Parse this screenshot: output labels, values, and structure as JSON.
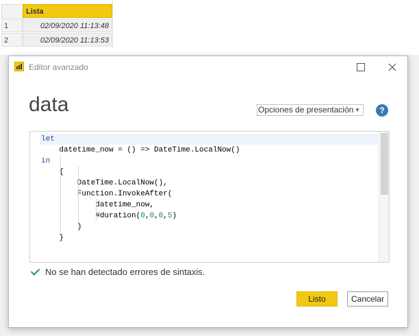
{
  "grid": {
    "column_header": "Lista",
    "rows": [
      {
        "num": "1",
        "value": "02/09/2020 11:13:48"
      },
      {
        "num": "2",
        "value": "02/09/2020 11:13:53"
      }
    ]
  },
  "dialog": {
    "title": "Editor avanzado",
    "query_name": "data",
    "options_label": "Opciones de presentación",
    "help_glyph": "?",
    "status_text": "No se han detectado errores de sintaxis.",
    "ok_label": "Listo",
    "cancel_label": "Cancelar"
  },
  "colors": {
    "accent_yellow": "#f2c811",
    "keyword_blue": "#1f4ea8",
    "number_green": "#098658",
    "check_green": "#2e8b57",
    "help_blue": "#3c78b4"
  },
  "code_lines": [
    "let",
    "    datetime_now = () => DateTime.LocalNow()",
    "in",
    "    {",
    "        DateTime.LocalNow(),",
    "        Function.InvokeAfter(",
    "            datetime_now,",
    "            #duration(0,0,0,5)",
    "        )",
    "    }"
  ],
  "icons": {
    "app": "power-bi-icon",
    "maximize": "maximize-icon",
    "close": "close-icon",
    "check": "check-icon",
    "help": "help-icon",
    "dropdown": "chevron-down-icon"
  }
}
